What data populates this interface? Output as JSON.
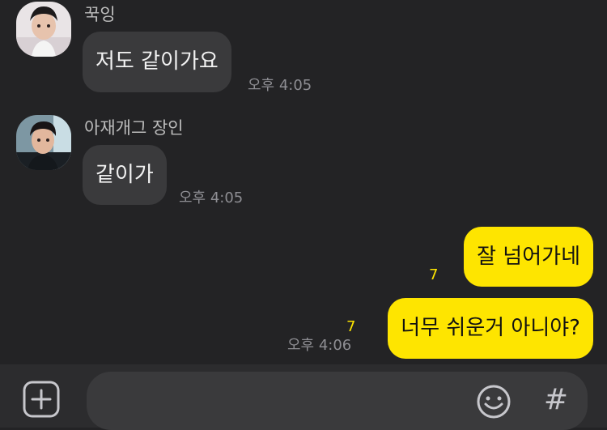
{
  "theme": {
    "background": "#232325",
    "incoming_bubble": "#3a3a3c",
    "outgoing_bubble": "#fee500",
    "timestamp_color": "#8e8e93",
    "unread_color": "#fee500"
  },
  "messages": [
    {
      "direction": "incoming",
      "sender": "꾹잉",
      "text": "저도 같이가요",
      "time": "오후 4:05"
    },
    {
      "direction": "incoming",
      "sender": "아재개그 장인",
      "text": "같이가",
      "time": "오후 4:05"
    },
    {
      "direction": "outgoing",
      "text": "잘 넘어가네",
      "unread": "7"
    },
    {
      "direction": "outgoing",
      "text": "너무 쉬운거 아니야?",
      "unread": "7",
      "time": "오후 4:06"
    }
  ],
  "composer": {
    "add_icon": "plus-square-icon",
    "emoji_icon": "smiley-icon",
    "hash_label": "#",
    "input_value": ""
  }
}
